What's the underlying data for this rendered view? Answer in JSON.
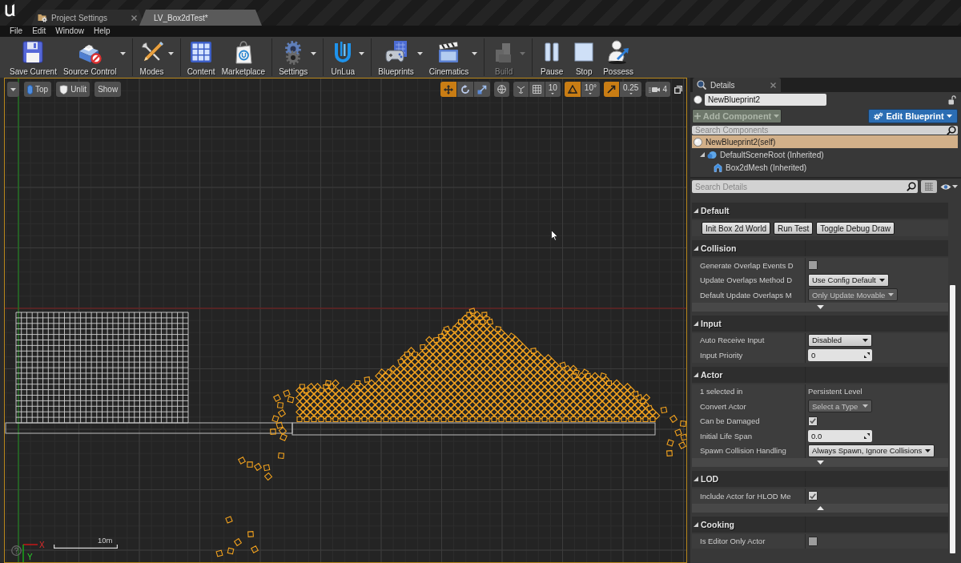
{
  "title_bar": {
    "tabs": [
      {
        "label": "Project Settings",
        "selected": false
      },
      {
        "label": "LV_Box2dTest*",
        "selected": true
      }
    ]
  },
  "menu_bar": {
    "items": [
      "File",
      "Edit",
      "Window",
      "Help"
    ]
  },
  "toolbar": {
    "groups": [
      [
        {
          "label": "Save Current",
          "dropdown": false,
          "disabled": false
        },
        {
          "label": "Source Control",
          "dropdown": true,
          "disabled": false
        }
      ],
      [
        {
          "label": "Modes",
          "dropdown": true,
          "disabled": false
        }
      ],
      [
        {
          "label": "Content",
          "dropdown": false,
          "disabled": false
        },
        {
          "label": "Marketplace",
          "dropdown": false,
          "disabled": false
        }
      ],
      [
        {
          "label": "Settings",
          "dropdown": true,
          "disabled": false
        }
      ],
      [
        {
          "label": "UnLua",
          "dropdown": true,
          "disabled": false
        }
      ],
      [
        {
          "label": "Blueprints",
          "dropdown": true,
          "disabled": false
        },
        {
          "label": "Cinematics",
          "dropdown": true,
          "disabled": false
        }
      ],
      [
        {
          "label": "Build",
          "dropdown": true,
          "disabled": true
        }
      ],
      [
        {
          "label": "Pause",
          "dropdown": false,
          "disabled": false
        },
        {
          "label": "Stop",
          "dropdown": false,
          "disabled": false
        },
        {
          "label": "Possess",
          "dropdown": false,
          "disabled": false
        }
      ]
    ]
  },
  "viewport": {
    "toolbar": {
      "view_options": [
        {
          "label": "Top"
        },
        {
          "label": "Unlit"
        },
        {
          "label": "Show"
        }
      ],
      "transform_tools": [
        {
          "selected": true
        },
        {
          "selected": false
        },
        {
          "selected": false
        }
      ],
      "snaps": [
        {
          "value": "10",
          "on": false
        },
        {
          "value": "10°",
          "on": true
        },
        {
          "value": "0.25",
          "on": true
        }
      ],
      "camera_speed": "4"
    },
    "scale_label": "10m",
    "axis_labels": [
      "X",
      "Y"
    ]
  },
  "details": {
    "tab": "Details",
    "actor_name": "NewBlueprint2",
    "add_component": {
      "label": "Add Component",
      "disabled": true
    },
    "edit_blueprint": "Edit Blueprint",
    "component_search": {
      "placeholder": "Search Components"
    },
    "components": [
      {
        "label": "NewBlueprint2(self)",
        "kind": "actor",
        "selected": true,
        "children": [
          {
            "label": "DefaultSceneRoot (Inherited)",
            "kind": "scene",
            "selected": false,
            "expanded": true,
            "children": [
              {
                "label": "Box2dMesh (Inherited)",
                "kind": "mesh",
                "selected": false
              }
            ]
          }
        ]
      }
    ],
    "details_search": {
      "placeholder": "Search Details"
    },
    "categories": [
      {
        "title": "Default",
        "expanded": true,
        "rows": [
          {
            "kind": "buttons",
            "buttons": [
              "Init Box 2d World",
              "Run Test",
              "Toggle Debug Draw"
            ]
          }
        ]
      },
      {
        "title": "Collision",
        "expanded": true,
        "advanced_expanded": false,
        "rows": [
          {
            "kind": "checkbox",
            "label": "Generate Overlap Events D",
            "checked": false
          },
          {
            "kind": "combo",
            "label": "Update Overlaps Method D",
            "value": "Use Config Default",
            "disabled": false
          },
          {
            "kind": "combo",
            "label": "Default Update Overlaps M",
            "value": "Only Update Movable",
            "disabled": true
          }
        ]
      },
      {
        "title": "Input",
        "expanded": true,
        "rows": [
          {
            "kind": "combo",
            "label": "Auto Receive Input",
            "value": "Disabled",
            "disabled": false
          },
          {
            "kind": "number",
            "label": "Input Priority",
            "value": "0"
          }
        ]
      },
      {
        "title": "Actor",
        "expanded": true,
        "advanced_expanded": false,
        "rows": [
          {
            "kind": "text",
            "label": "1 selected in",
            "value": "Persistent Level"
          },
          {
            "kind": "combo",
            "label": "Convert Actor",
            "value": "Select a Type",
            "disabled": true
          },
          {
            "kind": "checkbox",
            "label": "Can be Damaged",
            "checked": true
          },
          {
            "kind": "number",
            "label": "Initial Life Span",
            "value": "0.0"
          },
          {
            "kind": "combo",
            "label": "Spawn Collision Handling",
            "value": "Always Spawn, Ignore Collisions",
            "disabled": false
          }
        ]
      },
      {
        "title": "LOD",
        "expanded": true,
        "advanced_expanded": true,
        "rows": [
          {
            "kind": "checkbox",
            "label": "Include Actor for HLOD Me",
            "checked": true
          }
        ]
      },
      {
        "title": "Cooking",
        "expanded": true,
        "rows": [
          {
            "kind": "checkbox",
            "label": "Is Editor Only Actor",
            "checked": false
          }
        ]
      }
    ]
  }
}
